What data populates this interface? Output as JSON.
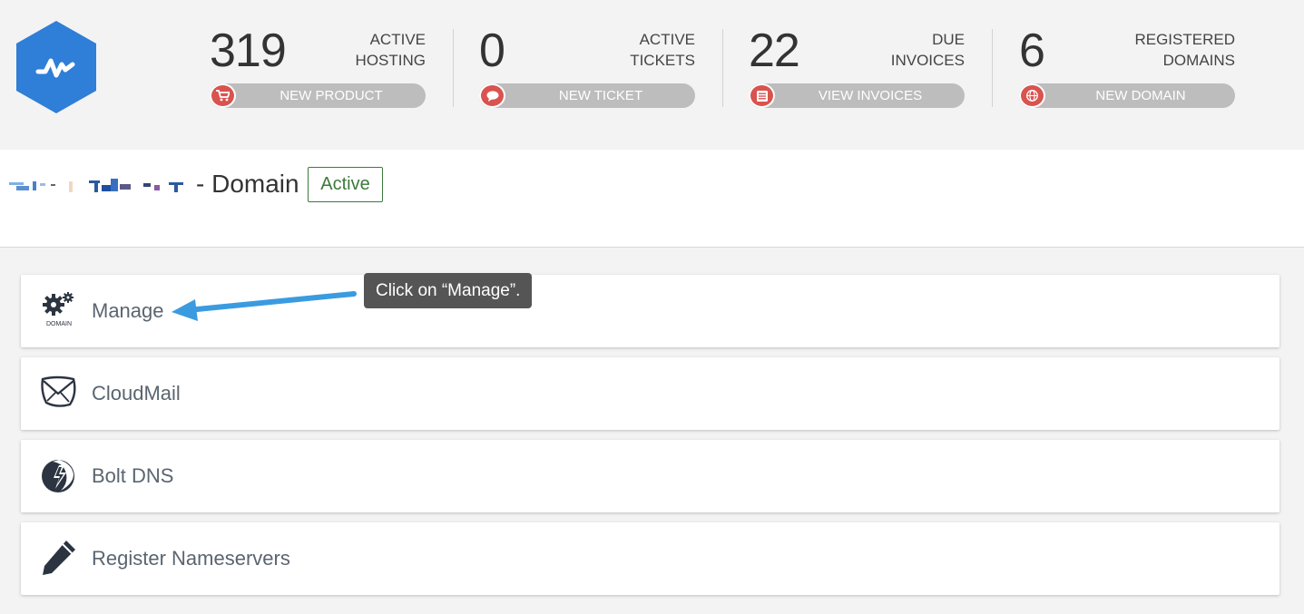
{
  "stats": [
    {
      "number": "319",
      "label_line1": "ACTIVE",
      "label_line2": "HOSTING",
      "button": "NEW PRODUCT",
      "icon": "cart-icon"
    },
    {
      "number": "0",
      "label_line1": "ACTIVE",
      "label_line2": "TICKETS",
      "button": "NEW TICKET",
      "icon": "chat-bubble-icon"
    },
    {
      "number": "22",
      "label_line1": "DUE",
      "label_line2": "INVOICES",
      "button": "VIEW INVOICES",
      "icon": "list-icon"
    },
    {
      "number": "6",
      "label_line1": "REGISTERED",
      "label_line2": "DOMAINS",
      "button": "NEW DOMAIN",
      "icon": "globe-icon"
    }
  ],
  "header": {
    "title": "- Domain",
    "status": "Active"
  },
  "cards": [
    {
      "label": "Manage",
      "icon": "domain-gears-icon",
      "icon_text": "DOMAIN"
    },
    {
      "label": "CloudMail",
      "icon": "cloudmail-icon"
    },
    {
      "label": "Bolt DNS",
      "icon": "bolt-dns-icon"
    },
    {
      "label": "Register Nameservers",
      "icon": "pencil-icon"
    }
  ],
  "annotation": {
    "tooltip": "Click on “Manage”."
  },
  "colors": {
    "brand_blue": "#2f7ed8",
    "button_gray": "#bdbdbd",
    "icon_red": "#d9534f",
    "status_green": "#3c7a3c",
    "arrow_blue": "#3b9be0"
  }
}
